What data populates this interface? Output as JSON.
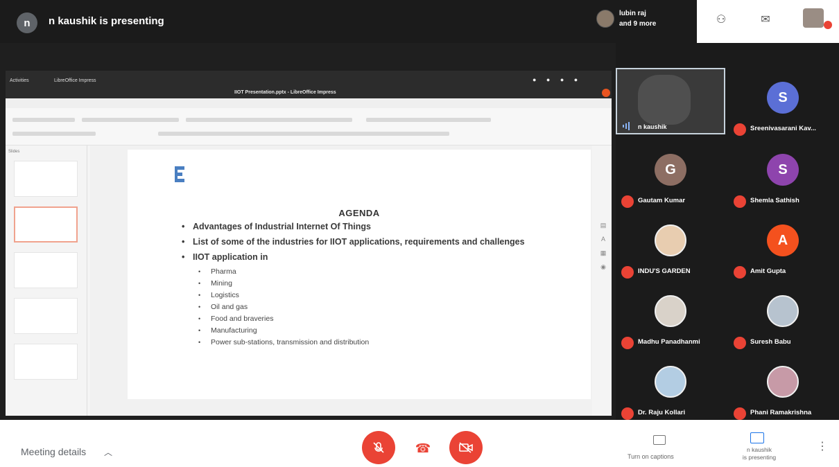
{
  "topbar": {
    "presenter_initial": "n",
    "presenting_label": "n kaushik is presenting",
    "others_line1": "lubin raj",
    "others_line2": "and 9 more"
  },
  "shared_screen": {
    "activities": "Activities",
    "app_name": "LibreOffice Impress",
    "doc_title": "IIOT Presentation.pptx - LibreOffice Impress",
    "slides_label": "Slides",
    "agenda": {
      "title": "AGENDA",
      "items": [
        "Advantages of Industrial Internet Of Things",
        "List of some of the industries for IIOT applications, requirements and challenges",
        "IIOT application in"
      ],
      "sub_items": [
        "Pharma",
        "Mining",
        "Logistics",
        "Oil and gas",
        "Food and braveries",
        "Manufacturing",
        "Power sub-stations, transmission and distribution"
      ]
    }
  },
  "participants": [
    {
      "name": "n kaushik",
      "type": "video"
    },
    {
      "name": "Sreenivasarani Kav...",
      "initial": "S",
      "color": "#5b6fd6"
    },
    {
      "name": "Gautam Kumar",
      "initial": "G",
      "color": "#8d6e63"
    },
    {
      "name": "Shemla Sathish",
      "initial": "S",
      "color": "#8e44ad"
    },
    {
      "name": "INDU'S GARDEN",
      "initial": "",
      "color": "#d8cfc4"
    },
    {
      "name": "Amit Gupta",
      "initial": "A",
      "color": "#f4511e"
    },
    {
      "name": "Madhu Panadhanmi",
      "initial": "",
      "color": "#d8cfc4"
    },
    {
      "name": "Suresh Babu",
      "initial": "",
      "color": "#d8cfc4"
    },
    {
      "name": "Dr. Raju Kollari",
      "initial": "",
      "color": "#d8cfc4"
    },
    {
      "name": "Phani Ramakrishna",
      "initial": "",
      "color": "#d8cfc4"
    }
  ],
  "bottombar": {
    "meeting_details": "Meeting details",
    "captions_label": "Turn on captions",
    "presenting_line1": "n kaushik",
    "presenting_line2": "is presenting"
  },
  "colors": {
    "accent_red": "#ea4335",
    "present_blue": "#1a73e8"
  }
}
